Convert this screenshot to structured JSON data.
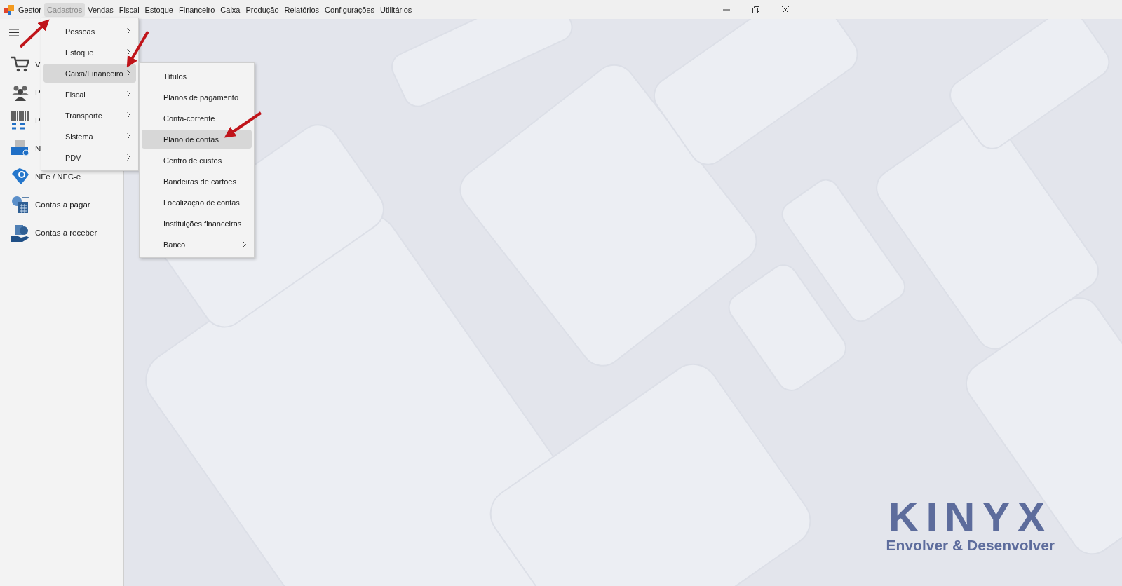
{
  "app_name": "Gestor",
  "menubar": [
    {
      "label": "Cadastros",
      "selected": true
    },
    {
      "label": "Vendas",
      "selected": false
    },
    {
      "label": "Fiscal",
      "selected": false
    },
    {
      "label": "Estoque",
      "selected": false
    },
    {
      "label": "Financeiro",
      "selected": false
    },
    {
      "label": "Caixa",
      "selected": false
    },
    {
      "label": "Produção",
      "selected": false
    },
    {
      "label": "Relatórios",
      "selected": false
    },
    {
      "label": "Configurações",
      "selected": false
    },
    {
      "label": "Utilitários",
      "selected": false
    }
  ],
  "sidebar": {
    "items": [
      {
        "label": "V"
      },
      {
        "label": "P"
      },
      {
        "label": "P"
      },
      {
        "label": "N"
      },
      {
        "label": "NFe / NFC-e"
      },
      {
        "label": "Contas a pagar"
      },
      {
        "label": "Contas a receber"
      }
    ]
  },
  "dropdown": {
    "items": [
      {
        "label": "Pessoas",
        "selected": false,
        "submenu": true
      },
      {
        "label": "Estoque",
        "selected": false,
        "submenu": true
      },
      {
        "label": "Caixa/Financeiro",
        "selected": true,
        "submenu": true
      },
      {
        "label": "Fiscal",
        "selected": false,
        "submenu": true
      },
      {
        "label": "Transporte",
        "selected": false,
        "submenu": true
      },
      {
        "label": "Sistema",
        "selected": false,
        "submenu": true
      },
      {
        "label": "PDV",
        "selected": false,
        "submenu": true
      }
    ]
  },
  "submenu": {
    "items": [
      {
        "label": "Títulos",
        "selected": false,
        "submenu": false
      },
      {
        "label": "Planos de pagamento",
        "selected": false,
        "submenu": false
      },
      {
        "label": "Conta-corrente",
        "selected": false,
        "submenu": false
      },
      {
        "label": "Plano de contas",
        "selected": true,
        "submenu": false
      },
      {
        "label": "Centro de custos",
        "selected": false,
        "submenu": false
      },
      {
        "label": "Bandeiras de cartões",
        "selected": false,
        "submenu": false
      },
      {
        "label": "Localização de contas",
        "selected": false,
        "submenu": false
      },
      {
        "label": "Instituições financeiras",
        "selected": false,
        "submenu": false
      },
      {
        "label": "Banco",
        "selected": false,
        "submenu": true
      }
    ]
  },
  "logo": {
    "wordmark": "KINYX",
    "tagline": "Envolver & Desenvolver"
  }
}
